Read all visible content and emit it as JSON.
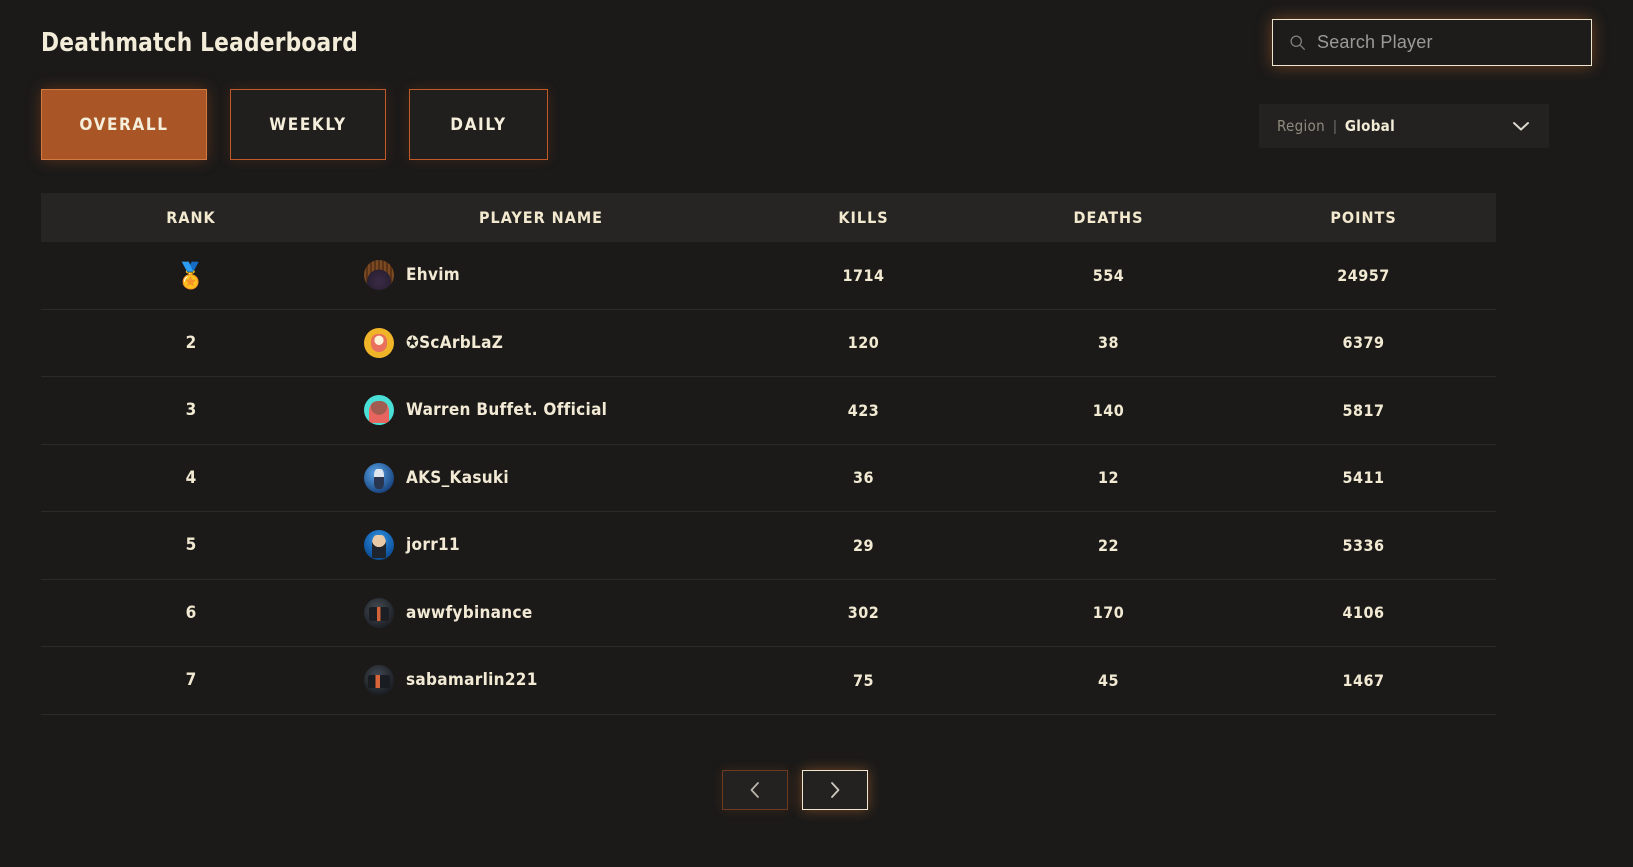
{
  "header": {
    "title": "Deathmatch Leaderboard"
  },
  "search": {
    "placeholder": "Search Player",
    "value": "",
    "icon": "search-icon"
  },
  "region": {
    "label": "Region",
    "separator": "|",
    "value": "Global",
    "icon": "chevron-down-icon"
  },
  "tabs": [
    {
      "label": "OVERALL",
      "active": true
    },
    {
      "label": "WEEKLY",
      "active": false
    },
    {
      "label": "DAILY",
      "active": false
    }
  ],
  "table": {
    "columns": [
      "RANK",
      "PLAYER NAME",
      "KILLS",
      "DEATHS",
      "POINTS"
    ],
    "rows": [
      {
        "rank": "",
        "rank_icon": "gold-medal-icon",
        "player": "Ehvim",
        "kills": "1714",
        "deaths": "554",
        "points": "24957"
      },
      {
        "rank": "2",
        "rank_icon": "",
        "player": "✪ScArbLaZ",
        "kills": "120",
        "deaths": "38",
        "points": "6379"
      },
      {
        "rank": "3",
        "rank_icon": "",
        "player": "Warren Buffet. Official",
        "kills": "423",
        "deaths": "140",
        "points": "5817"
      },
      {
        "rank": "4",
        "rank_icon": "",
        "player": "AKS_Kasuki",
        "kills": "36",
        "deaths": "12",
        "points": "5411"
      },
      {
        "rank": "5",
        "rank_icon": "",
        "player": "jorr11",
        "kills": "29",
        "deaths": "22",
        "points": "5336"
      },
      {
        "rank": "6",
        "rank_icon": "",
        "player": "awwfybinance",
        "kills": "302",
        "deaths": "170",
        "points": "4106"
      },
      {
        "rank": "7",
        "rank_icon": "",
        "player": "sabamarlin221",
        "kills": "75",
        "deaths": "45",
        "points": "1467"
      }
    ]
  },
  "pagination": {
    "prev_icon": "chevron-left-icon",
    "next_icon": "chevron-right-icon",
    "prev_enabled": false,
    "next_enabled": true
  },
  "colors": {
    "background": "#1b1a19",
    "header_strip": "#262524",
    "accent_orange": "#c25a28",
    "text_cream": "#f2ead4",
    "muted": "#8e8b7e",
    "row_divider": "#2c2b29"
  }
}
